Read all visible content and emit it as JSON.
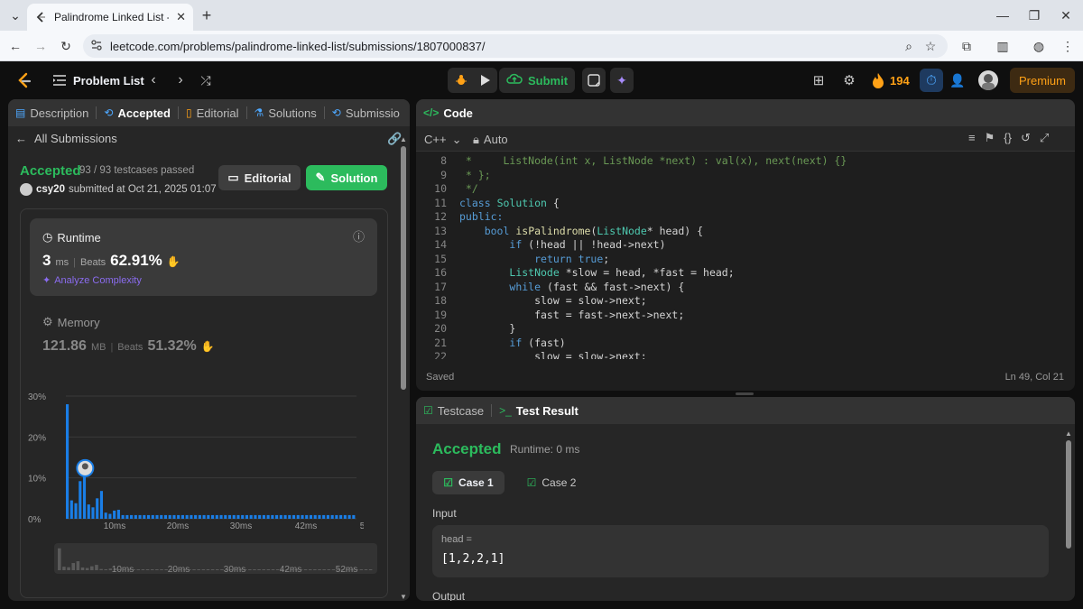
{
  "browser": {
    "tab_title": "Palindrome Linked List - LeetCo",
    "url": "leetcode.com/problems/palindrome-linked-list/submissions/1807000837/"
  },
  "nav": {
    "problem_list": "Problem List",
    "submit": "Submit",
    "streak": "194",
    "premium": "Premium"
  },
  "left": {
    "tabs": [
      "Description",
      "Accepted",
      "Editorial",
      "Solutions",
      "Submissio"
    ],
    "all_submissions": "All Submissions",
    "status": "Accepted",
    "testcases": "93 / 93 testcases passed",
    "user": "csy20",
    "submitted_at": "submitted at Oct 21, 2025 01:07",
    "editorial_btn": "Editorial",
    "solution_btn": "Solution",
    "runtime_label": "Runtime",
    "runtime_value": "3",
    "runtime_unit": "ms",
    "beats_label": "Beats",
    "runtime_beats": "62.91%",
    "analyze": "Analyze Complexity",
    "memory_label": "Memory",
    "memory_value": "121.86",
    "memory_unit": "MB",
    "memory_beats": "51.32%"
  },
  "chart_data": {
    "type": "bar",
    "y_ticks": [
      "30%",
      "20%",
      "10%",
      "0%"
    ],
    "x_ticks": [
      "10ms",
      "20ms",
      "30ms",
      "42ms",
      "52ms"
    ],
    "ylim": [
      0,
      30
    ],
    "values": [
      28,
      4.5,
      3.8,
      9.2,
      11.5,
      3.5,
      2.8,
      5,
      6.8,
      1.5,
      1.2,
      2,
      2.2,
      0.9,
      0.9,
      0.9,
      0.9,
      0.9,
      0.9,
      0.9,
      0.9,
      0.9,
      0.9,
      0.9,
      0.9,
      0.9,
      0.9,
      0.9,
      0.9,
      0.9,
      0.9,
      0.9,
      0.9,
      0.9,
      0.9,
      0.9,
      0.9,
      0.9,
      0.9,
      0.9,
      0.9,
      0.9,
      0.9,
      0.9,
      0.9,
      0.9,
      0.9,
      0.9,
      0.9,
      0.9,
      0.9,
      0.9,
      0.9,
      0.9,
      0.9,
      0.9,
      0.9,
      0.9,
      0.9,
      0.9,
      0.9,
      0.9,
      0.9,
      0.9,
      0.9,
      0.9,
      0.9,
      0.9
    ],
    "highlight_index": 4
  },
  "code": {
    "title": "Code",
    "lang": "C++",
    "auto": "Auto",
    "saved": "Saved",
    "cursor": "Ln 49, Col 21",
    "lines": [
      {
        "n": "8",
        "t": " *     ListNode(int x, ListNode *next) : val(x), next(next) {}",
        "c": "cm"
      },
      {
        "n": "9",
        "t": " * };",
        "c": "cm"
      },
      {
        "n": "10",
        "t": " */",
        "c": "cm"
      },
      {
        "n": "11",
        "t": "class Solution {",
        "c": "mix1"
      },
      {
        "n": "12",
        "t": "public:",
        "c": "kw"
      },
      {
        "n": "13",
        "t": "    bool isPalindrome(ListNode* head) {",
        "c": "mix2"
      },
      {
        "n": "14",
        "t": "        if (!head || !head->next)",
        "c": "mix3"
      },
      {
        "n": "15",
        "t": "            return true;",
        "c": "mix4"
      },
      {
        "n": "16",
        "t": "        ListNode *slow = head, *fast = head;",
        "c": "pl"
      },
      {
        "n": "17",
        "t": "        while (fast && fast->next) {",
        "c": "mix5"
      },
      {
        "n": "18",
        "t": "            slow = slow->next;",
        "c": "pl"
      },
      {
        "n": "19",
        "t": "            fast = fast->next->next;",
        "c": "pl"
      },
      {
        "n": "20",
        "t": "        }",
        "c": "pl"
      },
      {
        "n": "21",
        "t": "        if (fast)",
        "c": "mix6"
      },
      {
        "n": "22",
        "t": "            slow = slow->next;",
        "c": "pl"
      }
    ]
  },
  "test": {
    "testcase_tab": "Testcase",
    "result_tab": "Test Result",
    "status": "Accepted",
    "runtime": "Runtime: 0 ms",
    "case1": "Case 1",
    "case2": "Case 2",
    "input_label": "Input",
    "param": "head =",
    "value": "[1,2,2,1]",
    "output_label": "Output"
  }
}
